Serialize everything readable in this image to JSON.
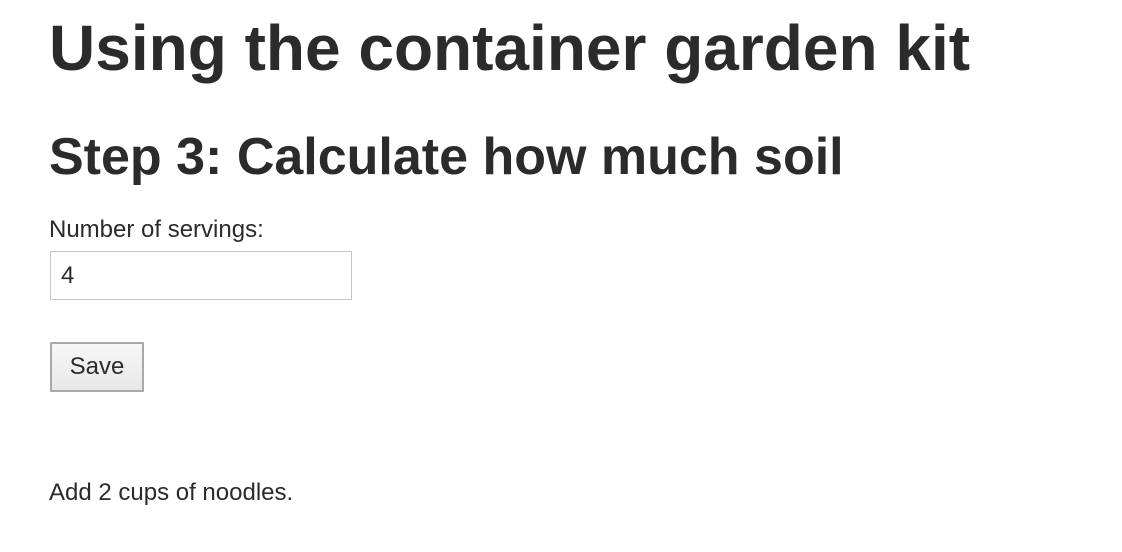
{
  "header": {
    "title": "Using the container garden kit",
    "step_heading": "Step 3: Calculate how much soil"
  },
  "form": {
    "servings_label": "Number of servings:",
    "servings_value": "4",
    "save_label": "Save"
  },
  "result": {
    "text": "Add 2 cups of noodles."
  }
}
